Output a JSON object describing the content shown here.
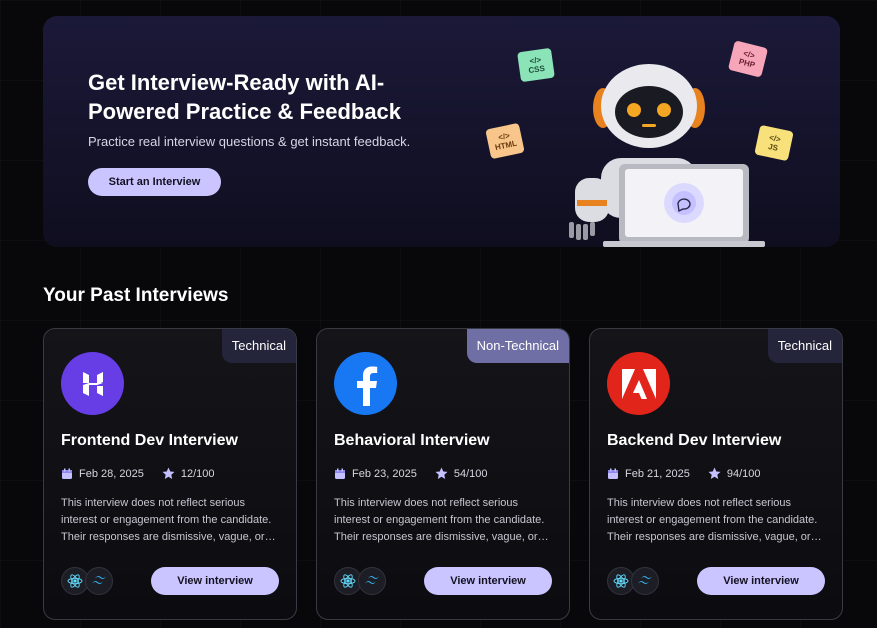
{
  "hero": {
    "title": "Get Interview-Ready with AI-Powered Practice & Feedback",
    "subtitle": "Practice real interview questions & get instant feedback.",
    "cta_label": "Start an Interview",
    "tags": [
      {
        "icon": "</>",
        "label": "CSS"
      },
      {
        "icon": "</>",
        "label": "PHP"
      },
      {
        "icon": "</>",
        "label": "HTML"
      },
      {
        "icon": "</>",
        "label": "JS"
      }
    ]
  },
  "section": {
    "title": "Your Past Interviews"
  },
  "colors": {
    "accent": "#cac5fe",
    "technical_badge": "#24243a",
    "non_technical_badge": "#6f6fa6",
    "hostinger": "#673de6",
    "facebook": "#1877f2",
    "adobe": "#e1251b"
  },
  "cards": [
    {
      "type": "Technical",
      "logo": "hostinger-logo-icon",
      "title": "Frontend Dev Interview",
      "date": "Feb 28, 2025",
      "score": "12/100",
      "description": "This interview does not reflect serious interest or engagement from the candidate. Their responses are dismissive, vague, or off-topic.",
      "tech": [
        "react-icon",
        "tailwind-icon"
      ],
      "button_label": "View interview"
    },
    {
      "type": "Non-Technical",
      "logo": "facebook-logo-icon",
      "title": "Behavioral Interview",
      "date": "Feb 23, 2025",
      "score": "54/100",
      "description": "This interview does not reflect serious interest or engagement from the candidate. Their responses are dismissive, vague, or off-topic.",
      "tech": [
        "react-icon",
        "tailwind-icon"
      ],
      "button_label": "View interview"
    },
    {
      "type": "Technical",
      "logo": "adobe-logo-icon",
      "title": "Backend Dev Interview",
      "date": "Feb 21, 2025",
      "score": "94/100",
      "description": "This interview does not reflect serious interest or engagement from the candidate. Their responses are dismissive, vague, or off-topic.",
      "tech": [
        "react-icon",
        "tailwind-icon"
      ],
      "button_label": "View interview"
    }
  ]
}
